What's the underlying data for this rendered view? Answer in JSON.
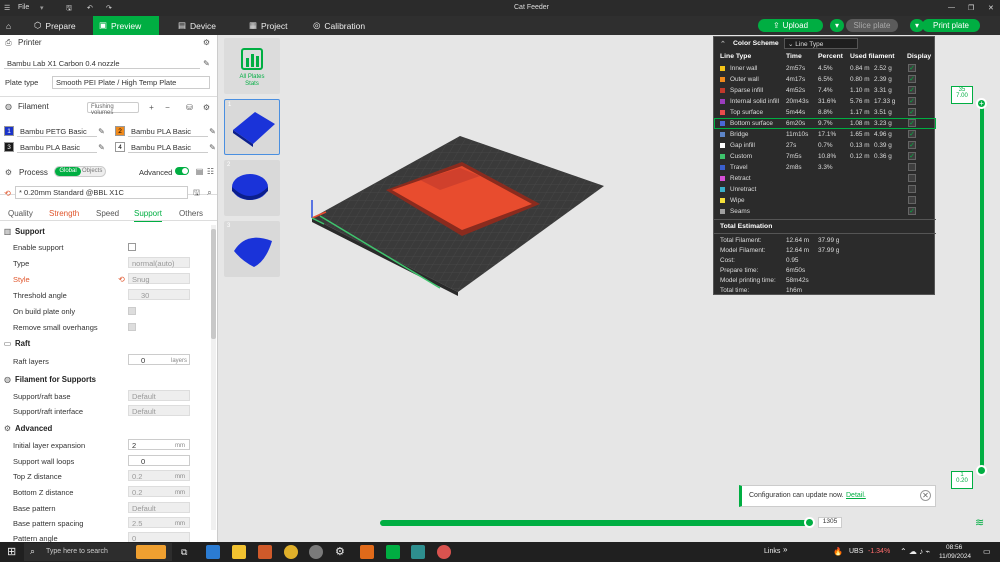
{
  "titlebar": {
    "menu": "File",
    "title": "Cat Feeder"
  },
  "nav": {
    "tabs": [
      {
        "label": "Prepare"
      },
      {
        "label": "Preview"
      },
      {
        "label": "Device"
      },
      {
        "label": "Project"
      },
      {
        "label": "Calibration"
      }
    ],
    "upload": "Upload",
    "slice_plate": "Slice plate",
    "print_plate": "Print plate"
  },
  "printer": {
    "section": "Printer",
    "name": "Bambu Lab X1 Carbon 0.4 nozzle",
    "plate_type_label": "Plate type",
    "plate_type": "Smooth PEI Plate / High Temp Plate"
  },
  "filament": {
    "section": "Filament",
    "flushing": "Flushing volumes",
    "items": [
      {
        "num": "1",
        "name": "Bambu PETG Basic",
        "color": "#1a33c9"
      },
      {
        "num": "2",
        "name": "Bambu PLA Basic",
        "color": "#f08a1c"
      },
      {
        "num": "3",
        "name": "Bambu PLA Basic",
        "color": "#1a1a1a"
      },
      {
        "num": "4",
        "name": "Bambu PLA Basic",
        "color": "#ffffff"
      }
    ]
  },
  "process": {
    "section": "Process",
    "global": "Global",
    "objects": "Objects",
    "advanced": "Advanced",
    "preset": "* 0.20mm Standard @BBL X1C",
    "tabs": [
      "Quality",
      "Strength",
      "Speed",
      "Support",
      "Others"
    ]
  },
  "settings": {
    "support_hd": "Support",
    "enable_support": "Enable support",
    "type_label": "Type",
    "type_value": "normal(auto)",
    "style_label": "Style",
    "style_value": "Snug",
    "threshold_label": "Threshold angle",
    "threshold_value": "30",
    "on_build_plate": "On build plate only",
    "remove_small": "Remove small overhangs",
    "raft_hd": "Raft",
    "raft_layers": "Raft layers",
    "raft_layers_value": "0",
    "raft_layers_unit": "layers",
    "fil_support_hd": "Filament for Supports",
    "support_base": "Support/raft base",
    "support_base_value": "Default",
    "support_interface": "Support/raft interface",
    "support_interface_value": "Default",
    "advanced_hd": "Advanced",
    "initial_layer_exp": "Initial layer expansion",
    "initial_layer_exp_value": "2",
    "mm": "mm",
    "wall_loops": "Support wall loops",
    "wall_loops_value": "0",
    "top_z": "Top Z distance",
    "top_z_value": "0.2",
    "bottom_z": "Bottom Z distance",
    "bottom_z_value": "0.2",
    "base_pattern": "Base pattern",
    "base_pattern_value": "Default",
    "base_spacing": "Base pattern spacing",
    "base_spacing_value": "2.5",
    "pattern_angle": "Pattern angle",
    "pattern_angle_value": "0"
  },
  "thumbs": {
    "stats_label_1": "All Plates",
    "stats_label_2": "Stats",
    "nums": [
      "1",
      "2",
      "3"
    ]
  },
  "stats": {
    "color_scheme": "Color Scheme",
    "line_type": "Line Type",
    "headers": [
      "Line Type",
      "Time",
      "Percent",
      "Used filament",
      "Display"
    ],
    "rows": [
      {
        "name": "Inner wall",
        "time": "2m57s",
        "pct": "4.5%",
        "m": "0.84 m",
        "g": "2.52 g",
        "color": "#f5c518",
        "on": true
      },
      {
        "name": "Outer wall",
        "time": "4m17s",
        "pct": "6.5%",
        "m": "0.80 m",
        "g": "2.39 g",
        "color": "#f08a1c",
        "on": true
      },
      {
        "name": "Sparse infill",
        "time": "4m52s",
        "pct": "7.4%",
        "m": "1.10 m",
        "g": "3.31 g",
        "color": "#c0392b",
        "on": true
      },
      {
        "name": "Internal solid infill",
        "time": "20m43s",
        "pct": "31.6%",
        "m": "5.76 m",
        "g": "17.33 g",
        "color": "#9b3dbd",
        "on": true
      },
      {
        "name": "Top surface",
        "time": "5m44s",
        "pct": "8.8%",
        "m": "1.17 m",
        "g": "3.51 g",
        "color": "#e84c4c",
        "on": true
      },
      {
        "name": "Bottom surface",
        "time": "6m20s",
        "pct": "9.7%",
        "m": "1.08 m",
        "g": "3.23 g",
        "color": "#4a67d6",
        "on": true
      },
      {
        "name": "Bridge",
        "time": "11m10s",
        "pct": "17.1%",
        "m": "1.65 m",
        "g": "4.96 g",
        "color": "#5e86c9",
        "on": true
      },
      {
        "name": "Gap infill",
        "time": "27s",
        "pct": "0.7%",
        "m": "0.13 m",
        "g": "0.39 g",
        "color": "#ffffff",
        "on": true
      },
      {
        "name": "Custom",
        "time": "7m5s",
        "pct": "10.8%",
        "m": "0.12 m",
        "g": "0.36 g",
        "color": "#3ec46d",
        "on": true
      },
      {
        "name": "Travel",
        "time": "2m8s",
        "pct": "3.3%",
        "m": "",
        "g": "",
        "color": "#3a5fcd",
        "on": false
      },
      {
        "name": "Retract",
        "time": "",
        "pct": "",
        "m": "",
        "g": "",
        "color": "#d64fd6",
        "on": false
      },
      {
        "name": "Unretract",
        "time": "",
        "pct": "",
        "m": "",
        "g": "",
        "color": "#3ab0c9",
        "on": false
      },
      {
        "name": "Wipe",
        "time": "",
        "pct": "",
        "m": "",
        "g": "",
        "color": "#f5e03a",
        "on": false
      },
      {
        "name": "Seams",
        "time": "",
        "pct": "",
        "m": "",
        "g": "",
        "color": "#a0a0a0",
        "on": true
      }
    ],
    "total_est": "Total Estimation",
    "totals": [
      {
        "label": "Total Filament:",
        "v1": "12.64 m",
        "v2": "37.99 g"
      },
      {
        "label": "Model Filament:",
        "v1": "12.64 m",
        "v2": "37.99 g"
      },
      {
        "label": "Cost:",
        "v1": "0.95",
        "v2": ""
      },
      {
        "label": "Prepare time:",
        "v1": "6m50s",
        "v2": ""
      },
      {
        "label": "Model printing time:",
        "v1": "58m42s",
        "v2": ""
      },
      {
        "label": "Total time:",
        "v1": "1h6m",
        "v2": ""
      }
    ]
  },
  "slider": {
    "top_layer": "35",
    "top_height": "7.00",
    "bottom_layer": "1",
    "bottom_height": "0.20",
    "h_value": "1305"
  },
  "notification": {
    "text": "Configuration can update now.",
    "link": "Detail."
  },
  "taskbar": {
    "search": "Type here to search",
    "links": "Links",
    "stock": "UBS",
    "stock_change": "-1.34%",
    "time": "08:56",
    "date": "11/09/2024"
  },
  "colors": {
    "accent": "#00ae42",
    "dark": "#2b2b2b"
  }
}
